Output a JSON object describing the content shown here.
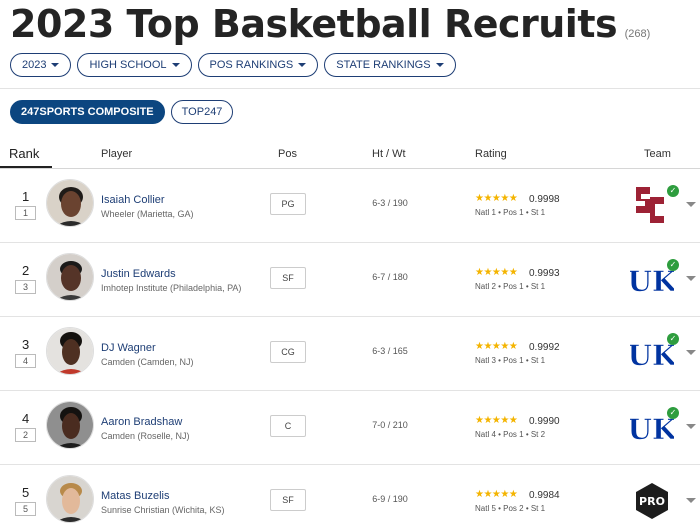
{
  "page": {
    "title": "2023 Top Basketball Recruits",
    "count": "(268)"
  },
  "filters": [
    {
      "label": "2023"
    },
    {
      "label": "HIGH SCHOOL"
    },
    {
      "label": "POS RANKINGS"
    },
    {
      "label": "STATE RANKINGS"
    }
  ],
  "tabs": [
    {
      "label": "247SPORTS COMPOSITE",
      "active": true
    },
    {
      "label": "TOP247",
      "active": false
    }
  ],
  "table": {
    "headers": {
      "rank": "Rank",
      "player": "Player",
      "pos": "Pos",
      "htwt": "Ht / Wt",
      "rating": "Rating",
      "team": "Team"
    },
    "rows": [
      {
        "rank": "1",
        "prev_rank": "1",
        "name": "Isaiah Collier",
        "school": "Wheeler (Marietta, GA)",
        "pos": "PG",
        "htwt": "6-3 / 190",
        "stars": "★★★★★",
        "rating": "0.9998",
        "subranks": "Natl 1 • Pos 1 • St 1",
        "team_logo": "usc-logo",
        "committed": true
      },
      {
        "rank": "2",
        "prev_rank": "3",
        "name": "Justin Edwards",
        "school": "Imhotep Institute (Philadelphia, PA)",
        "pos": "SF",
        "htwt": "6-7 / 180",
        "stars": "★★★★★",
        "rating": "0.9993",
        "subranks": "Natl 2 • Pos 1 • St 1",
        "team_logo": "kentucky-logo",
        "committed": true
      },
      {
        "rank": "3",
        "prev_rank": "4",
        "name": "DJ Wagner",
        "school": "Camden (Camden, NJ)",
        "pos": "CG",
        "htwt": "6-3 / 165",
        "stars": "★★★★★",
        "rating": "0.9992",
        "subranks": "Natl 3 • Pos 1 • St 1",
        "team_logo": "kentucky-logo",
        "committed": true
      },
      {
        "rank": "4",
        "prev_rank": "2",
        "name": "Aaron Bradshaw",
        "school": "Camden (Roselle, NJ)",
        "pos": "C",
        "htwt": "7-0 / 210",
        "stars": "★★★★★",
        "rating": "0.9990",
        "subranks": "Natl 4 • Pos 1 • St 2",
        "team_logo": "kentucky-logo",
        "committed": true
      },
      {
        "rank": "5",
        "prev_rank": "5",
        "name": "Matas Buzelis",
        "school": "Sunrise Christian (Wichita, KS)",
        "pos": "SF",
        "htwt": "6-9 / 190",
        "stars": "★★★★★",
        "rating": "0.9984",
        "subranks": "Natl 5 • Pos 2 • St 1",
        "team_logo": "pro-logo",
        "pro_label": "PRO",
        "committed": false
      }
    ]
  },
  "colors": {
    "navy": "#1e3e75",
    "active_tab": "#0c4680",
    "star": "#f4b400",
    "usc_red": "#9d2235",
    "kentucky_blue": "#0033a0",
    "check_green": "#2e9d3e"
  },
  "icons": {
    "caret": "chevron-down-icon",
    "check": "check-icon"
  }
}
